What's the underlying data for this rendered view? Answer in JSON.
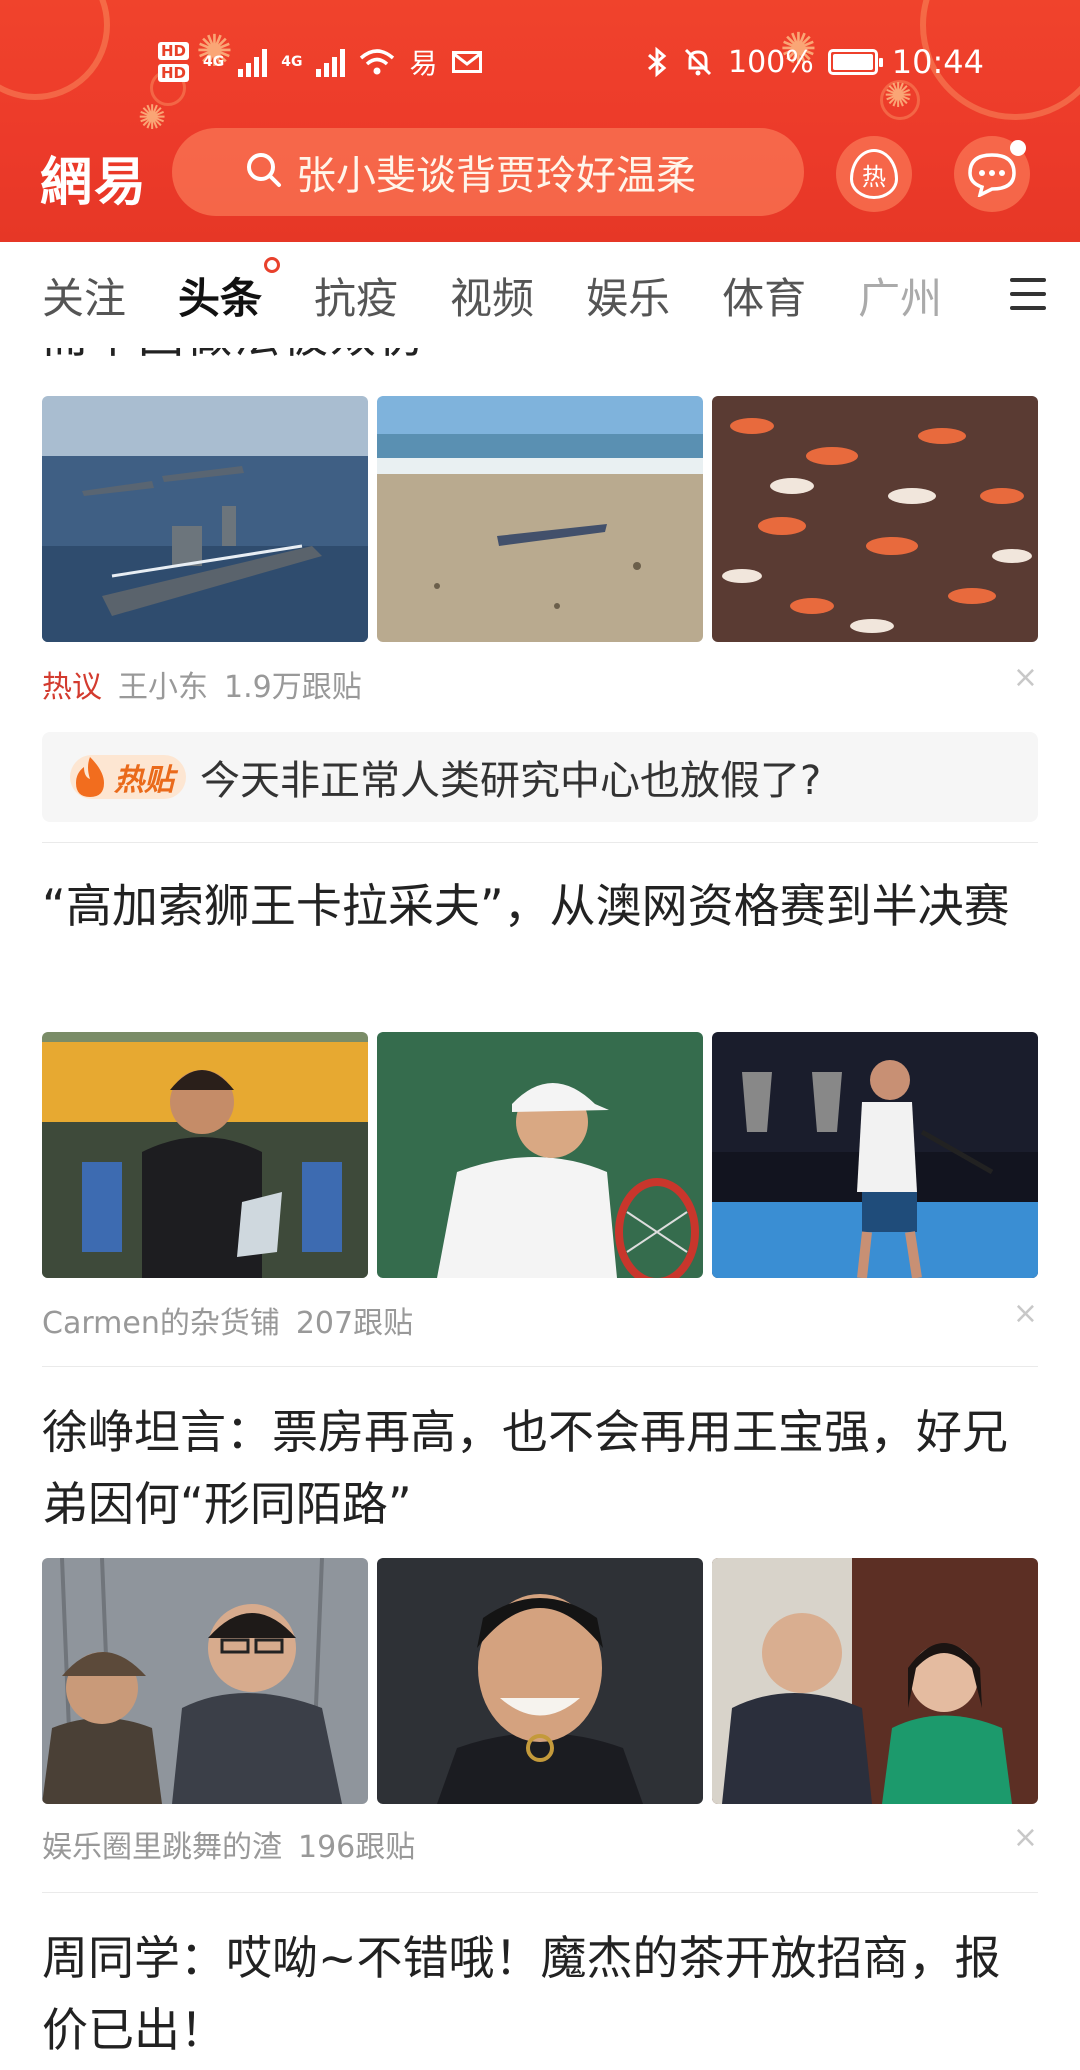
{
  "status": {
    "hd1": "HD",
    "hd2": "HD",
    "net1": "4G",
    "net2": "4G",
    "app_icon": "易",
    "battery": "100%",
    "time": "10:44"
  },
  "header": {
    "logo": "網易",
    "search_placeholder": "张小斐谈背贾玲好温柔",
    "hot_label": "热"
  },
  "tabs": [
    "关注",
    "头条",
    "抗疫",
    "视频",
    "娱乐",
    "体育",
    "广州"
  ],
  "feed": {
    "partial_title": "而中国做法被效仿",
    "item1": {
      "tag": "热议",
      "source": "王小东",
      "comments": "1.9万跟贴",
      "images": [
        "warships",
        "beach",
        "koi-fish"
      ]
    },
    "hotpost": {
      "badge": "热贴",
      "text": "今天非正常人类研究中心也放假了?"
    },
    "item2": {
      "title": "“高加索狮王卡拉采夫”，从澳网资格赛到半决赛",
      "source": "Carmen的杂货铺",
      "comments": "207跟贴"
    },
    "item3": {
      "title": "徐峥坦言：票房再高，也不会再用王宝强，好兄弟因何“形同陌路”",
      "source": "娱乐圈里跳舞的渣",
      "comments": "196跟贴"
    },
    "item4": {
      "title": "周同学：哎呦~不错哦！魔杰的茶开放招商，报价已出！"
    },
    "close": "×"
  },
  "colors": {
    "brand_red": "#e8412c",
    "hot_tag": "#d33b2f",
    "meta_gray": "#999999"
  }
}
